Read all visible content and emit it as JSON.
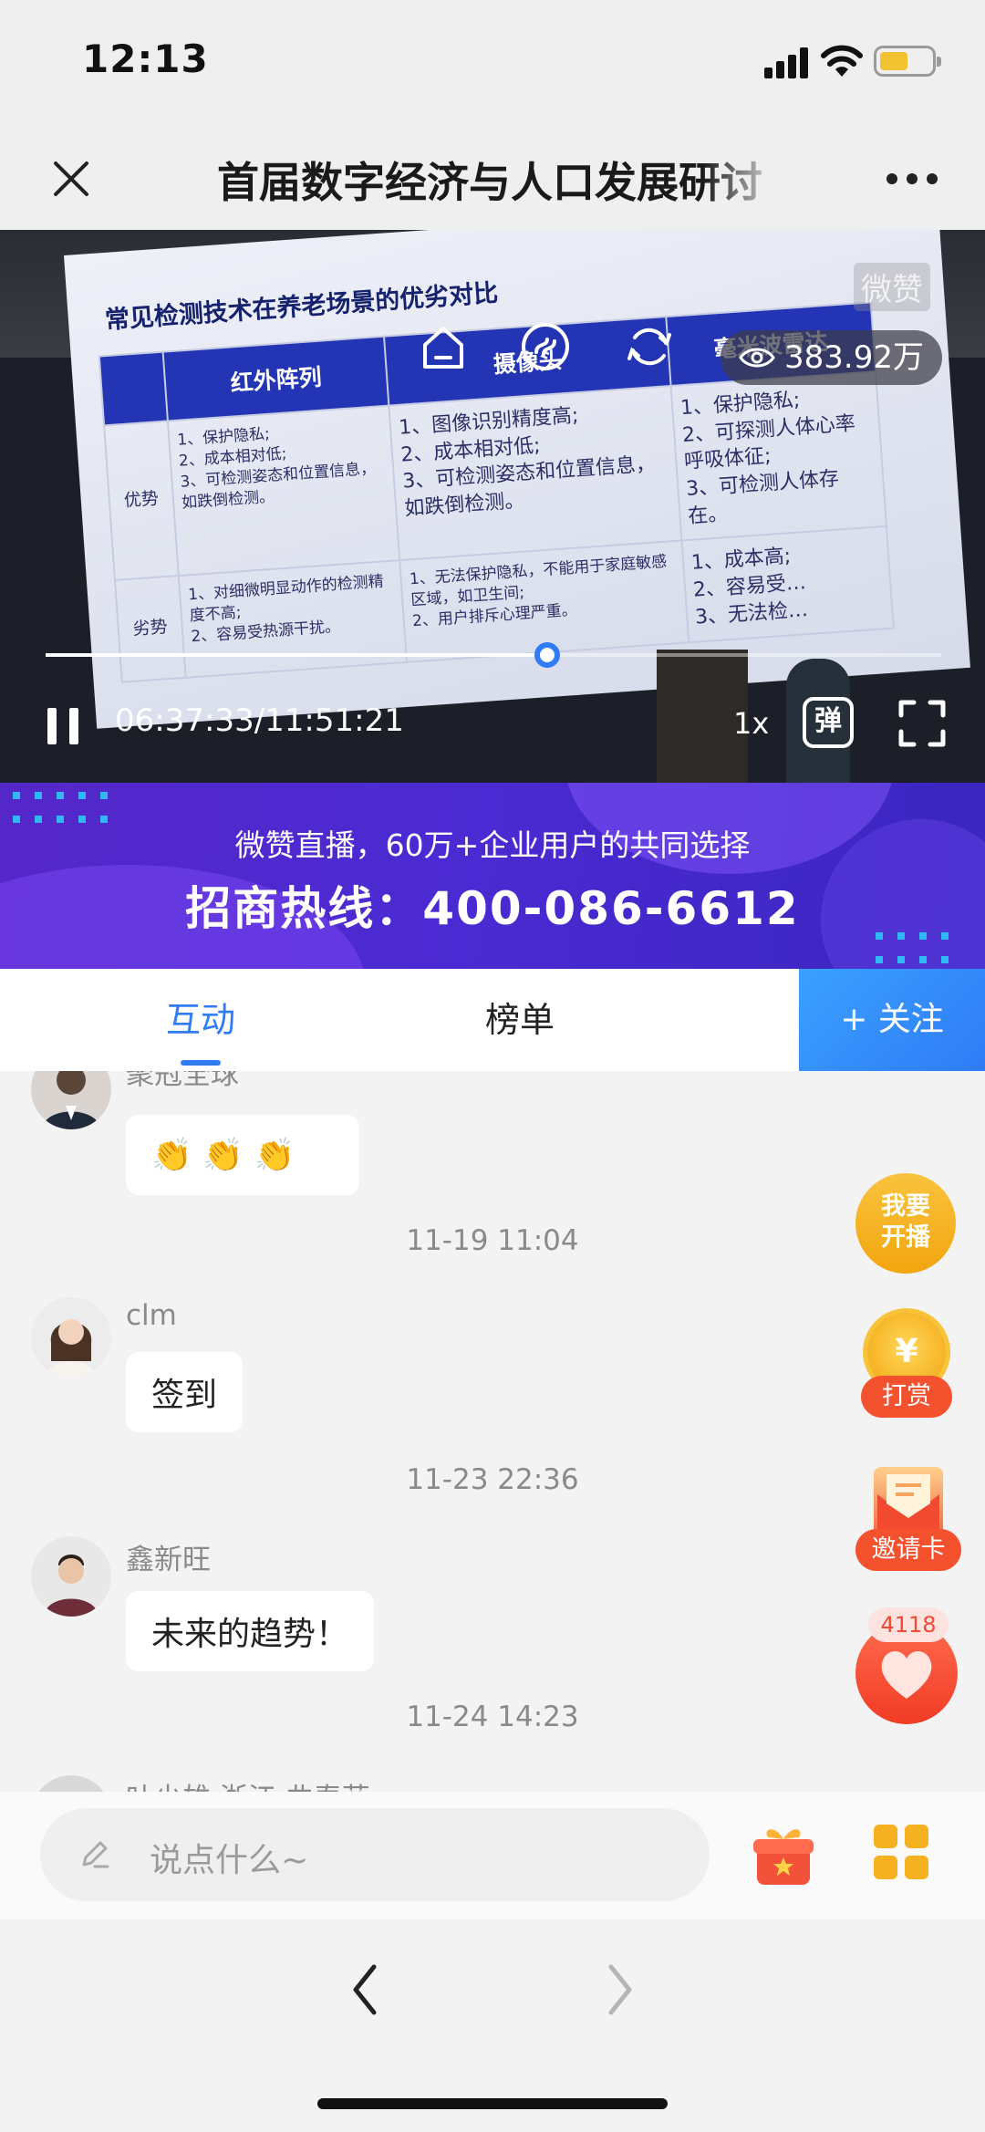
{
  "status_bar": {
    "time": "12:13"
  },
  "header": {
    "title": "首届数字经济与人口发展研讨"
  },
  "video": {
    "watermark": "微赞",
    "view_count": "383.92万",
    "time_current": "06:37:33",
    "time_total": "11:51:21",
    "time_separator": "/",
    "speed": "1x",
    "danmu_label": "弹",
    "progress_fraction": 0.56,
    "slide": {
      "title": "常见检测技术在养老场景的优劣对比",
      "columns": [
        "红外阵列",
        "摄像头",
        "毫米波雷达"
      ],
      "rows": [
        {
          "label": "优势",
          "cells": [
            "1、保护隐私;\n2、成本相对低;\n3、可检测姿态和位置信息，如跌倒检测。",
            "1、图像识别精度高;\n2、成本相对低;\n3、可检测姿态和位置信息，如跌倒检测。",
            "1、保护隐私;\n2、可探测人体心率呼吸体征;\n3、可检测人体存在。"
          ]
        },
        {
          "label": "劣势",
          "cells": [
            "1、对细微明显动作的检测精度不高;\n2、容易受热源干扰。",
            "1、无法保护隐私，不能用于家庭敏感区域，如卫生间;\n2、用户排斥心理严重。",
            "1、成本高;\n2、容易受…\n3、无法检…"
          ]
        }
      ]
    }
  },
  "banner": {
    "line1": "微赞直播，60万+企业用户的共同选择",
    "line2": "招商热线：400-086-6612"
  },
  "tabs": {
    "interact": "互动",
    "rank": "榜单",
    "follow": "+ 关注"
  },
  "chat": {
    "messages": [
      {
        "user": "聚冠全球",
        "text": "👏 👏 👏"
      },
      {
        "timestamp": "11-19 11:04"
      },
      {
        "user": "clm",
        "text": "签到"
      },
      {
        "timestamp": "11-23 22:36"
      },
      {
        "user": "鑫新旺",
        "text": "未来的趋势！"
      },
      {
        "timestamp": "11-24 14:23"
      },
      {
        "user": "叶少雄 浙江 曲春芬"
      }
    ]
  },
  "floating": {
    "live_label": "我要\n开播",
    "reward_coin": "¥",
    "reward_label": "打赏",
    "invite_label": "邀请卡",
    "like_count": "4118"
  },
  "input": {
    "placeholder": "说点什么~"
  },
  "colors": {
    "accent": "#2f7cf6",
    "reward": "#f4512f",
    "banner": "#4b2ad3",
    "like": "#f13b25"
  }
}
